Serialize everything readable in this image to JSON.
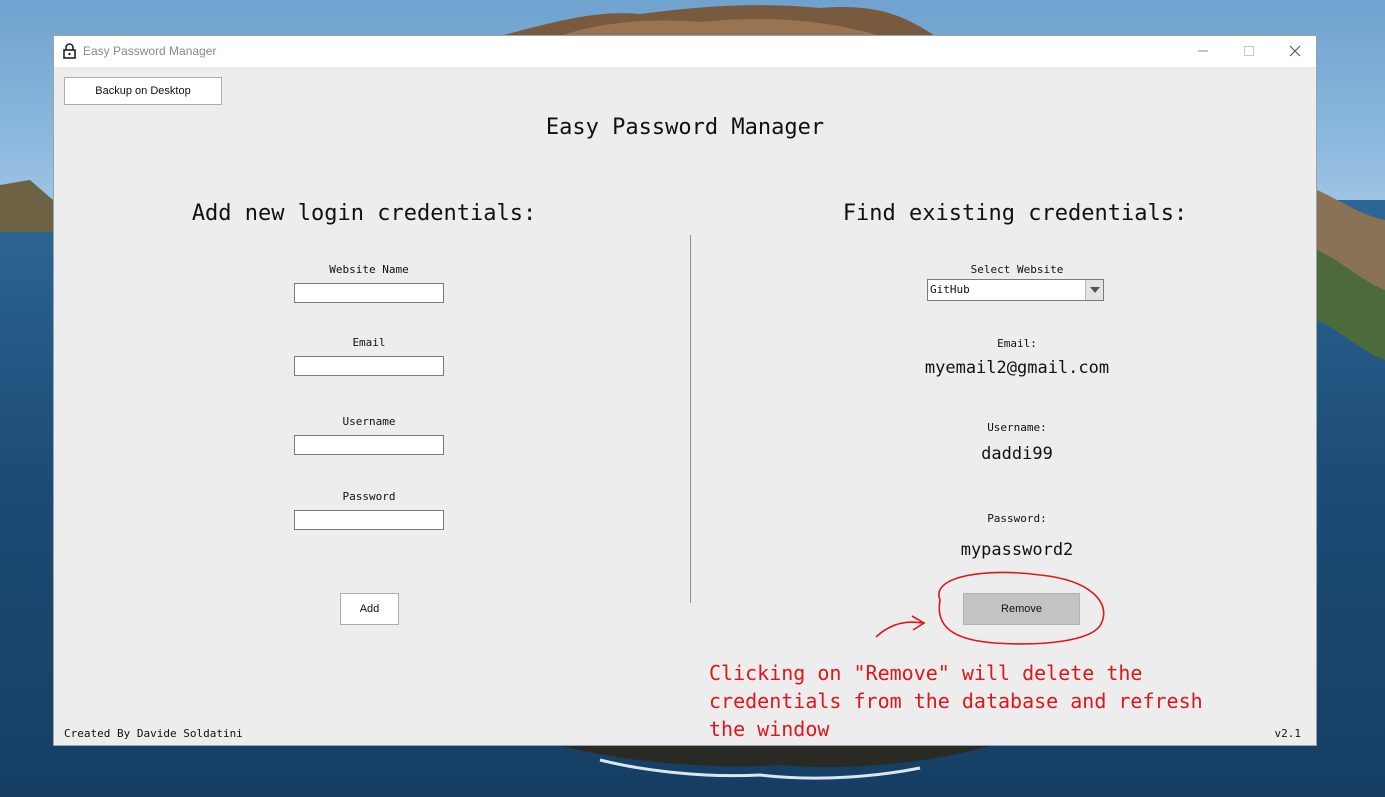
{
  "window": {
    "title": "Easy Password Manager",
    "icons": {
      "app": "lock-icon",
      "minimize": "minimize-icon",
      "maximize": "maximize-icon",
      "close": "close-icon"
    }
  },
  "header": {
    "backup_button": "Backup on Desktop",
    "app_title": "Easy Password Manager"
  },
  "add_section": {
    "title": "Add new login credentials:",
    "fields": {
      "website": {
        "label": "Website Name",
        "value": ""
      },
      "email": {
        "label": "Email",
        "value": ""
      },
      "username": {
        "label": "Username",
        "value": ""
      },
      "password": {
        "label": "Password",
        "value": ""
      }
    },
    "add_button": "Add"
  },
  "find_section": {
    "title": "Find existing credentials:",
    "select_label": "Select Website",
    "selected_website": "GitHub",
    "email_label": "Email:",
    "email_value": "myemail2@gmail.com",
    "username_label": "Username:",
    "username_value": "daddi99",
    "password_label": "Password:",
    "password_value": "mypassword2",
    "remove_button": "Remove"
  },
  "footer": {
    "credit": "Created By Davide Soldatini",
    "version": "v2.1"
  },
  "annotation": {
    "lines": [
      "Clicking on \"Remove\" will delete the",
      "credentials from the database and refresh",
      "the window"
    ],
    "color": "#e0161b"
  },
  "colors": {
    "window_bg": "#ededed",
    "remove_button_bg": "#c3c3c3"
  }
}
